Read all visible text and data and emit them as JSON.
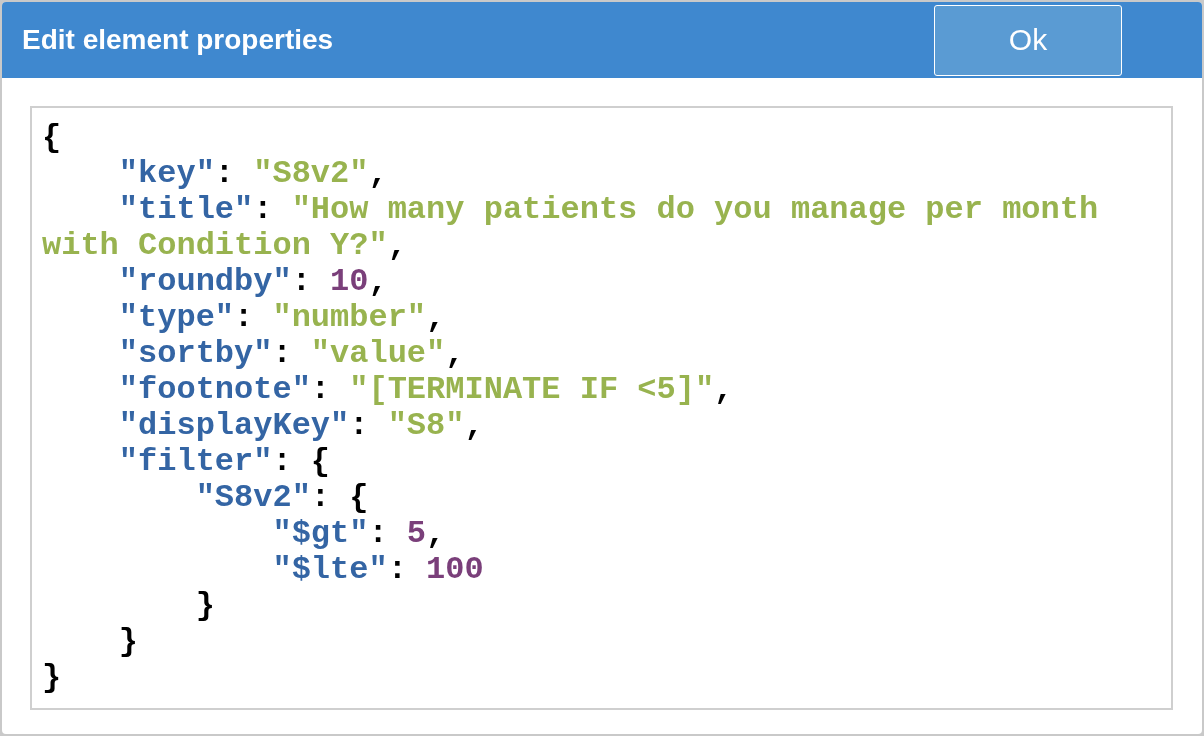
{
  "dialog": {
    "title": "Edit element properties",
    "ok_button": "Ok"
  },
  "editor": {
    "lines": [
      [
        {
          "kind": "punct",
          "text": "{"
        }
      ],
      [
        {
          "kind": "key",
          "text": "    \"key\""
        },
        {
          "kind": "punct",
          "text": ": "
        },
        {
          "kind": "string",
          "text": "\"S8v2\""
        },
        {
          "kind": "punct",
          "text": ","
        }
      ],
      [
        {
          "kind": "key",
          "text": "    \"title\""
        },
        {
          "kind": "punct",
          "text": ": "
        },
        {
          "kind": "string",
          "text": "\"How many patients do you manage per month"
        }
      ],
      [
        {
          "kind": "string",
          "text": "with Condition Y?\""
        },
        {
          "kind": "punct",
          "text": ","
        }
      ],
      [
        {
          "kind": "key",
          "text": "    \"roundby\""
        },
        {
          "kind": "punct",
          "text": ": "
        },
        {
          "kind": "number",
          "text": "10"
        },
        {
          "kind": "punct",
          "text": ","
        }
      ],
      [
        {
          "kind": "key",
          "text": "    \"type\""
        },
        {
          "kind": "punct",
          "text": ": "
        },
        {
          "kind": "string",
          "text": "\"number\""
        },
        {
          "kind": "punct",
          "text": ","
        }
      ],
      [
        {
          "kind": "key",
          "text": "    \"sortby\""
        },
        {
          "kind": "punct",
          "text": ": "
        },
        {
          "kind": "string",
          "text": "\"value\""
        },
        {
          "kind": "punct",
          "text": ","
        }
      ],
      [
        {
          "kind": "key",
          "text": "    \"footnote\""
        },
        {
          "kind": "punct",
          "text": ": "
        },
        {
          "kind": "string",
          "text": "\"[TERMINATE IF <5]\""
        },
        {
          "kind": "punct",
          "text": ","
        }
      ],
      [
        {
          "kind": "key",
          "text": "    \"displayKey\""
        },
        {
          "kind": "punct",
          "text": ": "
        },
        {
          "kind": "string",
          "text": "\"S8\""
        },
        {
          "kind": "punct",
          "text": ","
        }
      ],
      [
        {
          "kind": "key",
          "text": "    \"filter\""
        },
        {
          "kind": "punct",
          "text": ": {"
        }
      ],
      [
        {
          "kind": "key",
          "text": "        \"S8v2\""
        },
        {
          "kind": "punct",
          "text": ": {"
        }
      ],
      [
        {
          "kind": "key",
          "text": "            \"$gt\""
        },
        {
          "kind": "punct",
          "text": ": "
        },
        {
          "kind": "number",
          "text": "5"
        },
        {
          "kind": "punct",
          "text": ","
        }
      ],
      [
        {
          "kind": "key",
          "text": "            \"$lte\""
        },
        {
          "kind": "punct",
          "text": ": "
        },
        {
          "kind": "number",
          "text": "100"
        }
      ],
      [
        {
          "kind": "punct",
          "text": "        }"
        }
      ],
      [
        {
          "kind": "punct",
          "text": "    }"
        }
      ],
      [
        {
          "kind": "punct",
          "text": "}"
        }
      ]
    ]
  }
}
